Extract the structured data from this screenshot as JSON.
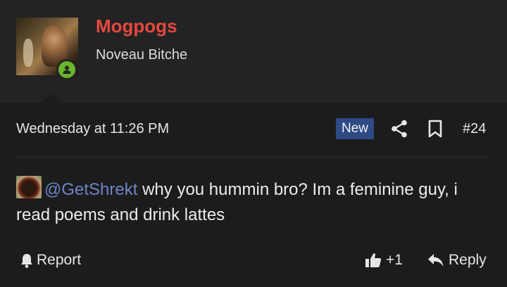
{
  "author": {
    "username": "Mogpogs",
    "user_title": "Noveau Bitche"
  },
  "post": {
    "date": "Wednesday at 11:26 PM",
    "badge": "New",
    "number": "#24",
    "mention": "@GetShrekt",
    "text": " why you hummin bro? Im a feminine guy, i read poems and drink lattes"
  },
  "actions": {
    "report": "Report",
    "like_count": "+1",
    "reply": "Reply"
  },
  "colors": {
    "username": "#e5483f",
    "mention": "#6d84c9",
    "new_badge": "#2d4a85",
    "online": "#6ab52a"
  }
}
